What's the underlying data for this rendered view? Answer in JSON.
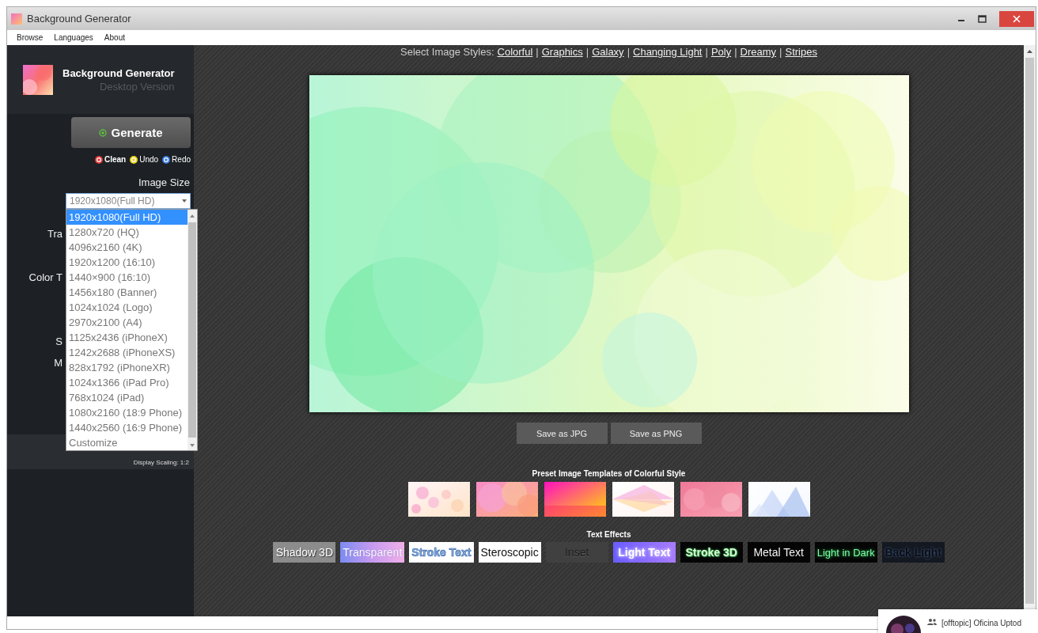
{
  "window": {
    "title": "Background Generator"
  },
  "menu": [
    {
      "label": "Browse"
    },
    {
      "label": "Languages"
    },
    {
      "label": "About"
    }
  ],
  "sidebar": {
    "app_name": "Background Generator",
    "subtitle": "Desktop Version",
    "generate_button": "Generate",
    "actions": [
      {
        "label": "Clean",
        "kind": "clean"
      },
      {
        "label": "Undo",
        "kind": "undo"
      },
      {
        "label": "Redo",
        "kind": "redo"
      }
    ],
    "image_size_label": "Image Size",
    "image_size": {
      "value": "1920x1080(Full HD)",
      "options": [
        {
          "label": "1920x1080(Full HD)",
          "selected": true
        },
        {
          "label": "1280x720 (HQ)",
          "selected": false
        },
        {
          "label": "4096x2160 (4K)",
          "selected": false
        },
        {
          "label": "1920x1200 (16:10)",
          "selected": false
        },
        {
          "label": "1440×900 (16:10)",
          "selected": false
        },
        {
          "label": "1456x180 (Banner)",
          "selected": false
        },
        {
          "label": "1024x1024 (Logo)",
          "selected": false
        },
        {
          "label": "2970x2100 (A4)",
          "selected": false
        },
        {
          "label": "1125x2436 (iPhoneX)",
          "selected": false
        },
        {
          "label": "1242x2688 (iPhoneXS)",
          "selected": false
        },
        {
          "label": "828x1792 (iPhoneXR)",
          "selected": false
        },
        {
          "label": "1024x1366 (iPad Pro)",
          "selected": false
        },
        {
          "label": "768x1024 (iPad)",
          "selected": false
        },
        {
          "label": "1080x2160 (18:9 Phone)",
          "selected": false
        },
        {
          "label": "1440x2560 (16:9 Phone)",
          "selected": false
        },
        {
          "label": "Customize",
          "selected": false
        }
      ]
    },
    "covered_labels": [
      "Tra",
      "Color T",
      "S",
      "M"
    ],
    "display_scaling": "Display Scaling: 1:2"
  },
  "main": {
    "styles_label": "Select Image Styles:",
    "styles_separator": "|",
    "styles": [
      {
        "label": "Colorful"
      },
      {
        "label": "Graphics"
      },
      {
        "label": "Galaxy"
      },
      {
        "label": "Changing Light"
      },
      {
        "label": "Poly"
      },
      {
        "label": "Dreamy"
      },
      {
        "label": "Stripes"
      }
    ],
    "save_buttons": [
      {
        "label": "Save as JPG"
      },
      {
        "label": "Save as PNG"
      }
    ],
    "templates_title": "Preset Image Templates of Colorful Style",
    "text_effects_title": "Text Effects",
    "text_effects": [
      {
        "label": "Shadow 3D",
        "kind": "shadow3d"
      },
      {
        "label": "Transparent",
        "kind": "transparent"
      },
      {
        "label": "Stroke Text",
        "kind": "stroke"
      },
      {
        "label": "Steroscopic",
        "kind": "stereoscopic"
      },
      {
        "label": "Inset",
        "kind": "inset"
      },
      {
        "label": "Light Text",
        "kind": "light"
      },
      {
        "label": "Stroke 3D",
        "kind": "stroke3d"
      },
      {
        "label": "Metal Text",
        "kind": "metal"
      },
      {
        "label": "Light in Dark",
        "kind": "lightdark"
      },
      {
        "label": "Back Light",
        "kind": "backlight"
      }
    ]
  },
  "notification": {
    "text": "[offtopic] Oficina Uptod"
  }
}
